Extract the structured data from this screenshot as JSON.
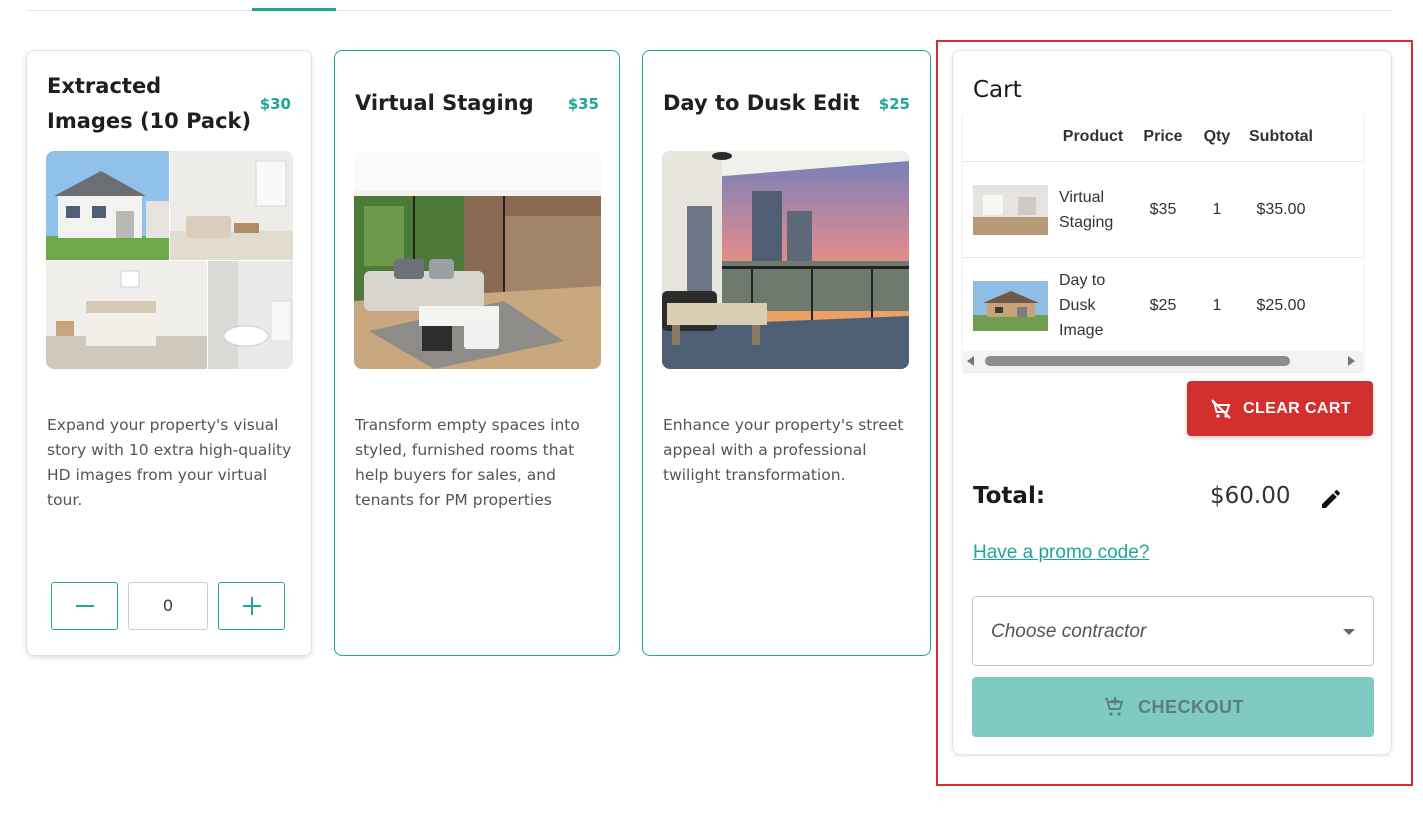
{
  "products": [
    {
      "title": "Extracted Images (10 Pack)",
      "price": "$30",
      "description": "Expand your property's visual story with 10 extra high-quality HD images from your virtual tour.",
      "quantity": "0"
    },
    {
      "title": "Virtual Staging",
      "price": "$35",
      "description": "Transform empty spaces into styled, furnished rooms that help buyers for sales, and tenants for PM properties"
    },
    {
      "title": "Day to Dusk Edit",
      "price": "$25",
      "description": "Enhance your property's street appeal with a professional twilight transformation."
    }
  ],
  "cart": {
    "title": "Cart",
    "columns": [
      "Product",
      "Price",
      "Qty",
      "Subtotal"
    ],
    "rows": [
      {
        "product_line1": "Virtual",
        "product_line2": "Staging",
        "product_line3": "",
        "price": "$35",
        "qty": "1",
        "subtotal": "$35.00"
      },
      {
        "product_line1": "Day to",
        "product_line2": "Dusk",
        "product_line3": "Image",
        "price": "$25",
        "qty": "1",
        "subtotal": "$25.00"
      }
    ],
    "clear_label": "CLEAR CART",
    "total_label": "Total:",
    "total_value": "$60.00",
    "promo_label": "Have a promo code?",
    "contractor_placeholder": "Choose contractor",
    "checkout_label": "CHECKOUT"
  },
  "colors": {
    "accent": "#1fa699",
    "danger": "#d32f2f",
    "checkout_disabled": "#7fcbc3"
  }
}
